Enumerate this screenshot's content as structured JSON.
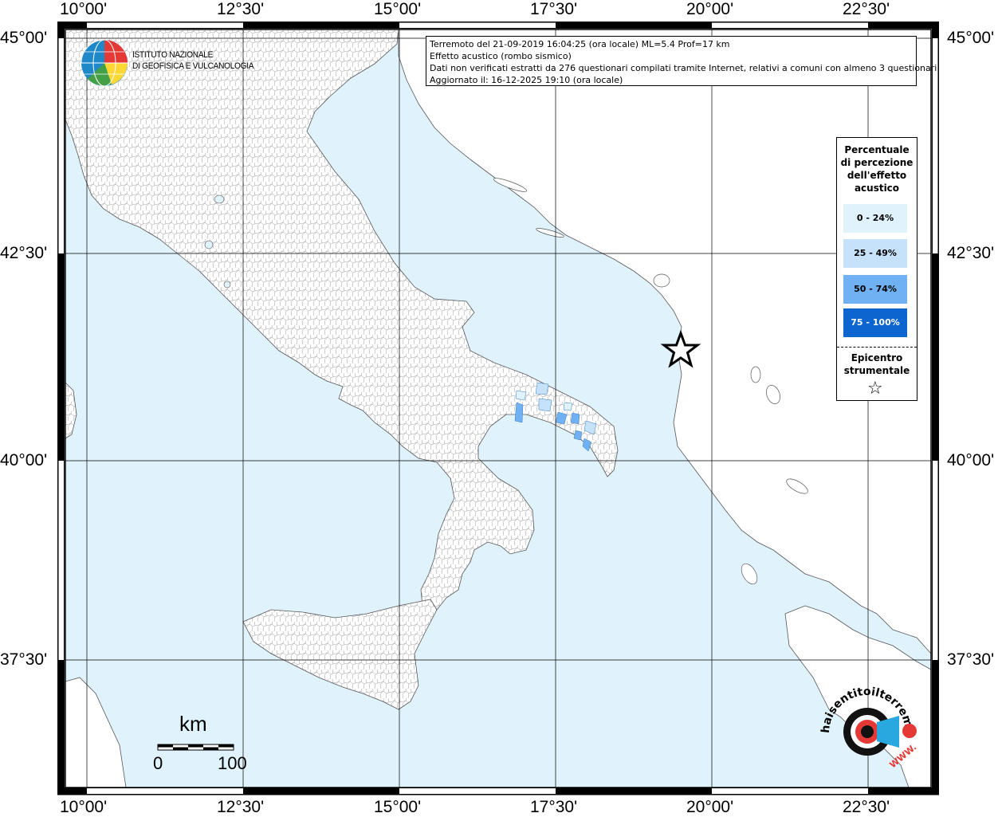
{
  "info": {
    "line1": "Terremoto del 21-09-2019 16:04:25 (ora locale) ML=5.4 Prof=17 km",
    "line2": "Effetto acustico (rombo sismico)",
    "line3": "Dati non verificati estratti da 276 questionari compilati tramite Internet, relativi a comuni con almeno 3 questionari.",
    "line4": "Aggiornato il: 16-12-2025 19:10 (ora locale)"
  },
  "institute": {
    "line1": "ISTITUTO NAZIONALE",
    "line2": "DI GEOFISICA E VULCANOLOGIA"
  },
  "axes": {
    "lon_ticks": [
      "10°00'",
      "12°30'",
      "15°00'",
      "17°30'",
      "20°00'",
      "22°30'"
    ],
    "lat_ticks": [
      "45°00'",
      "42°30'",
      "40°00'",
      "37°30'"
    ]
  },
  "legend": {
    "title": "Percentuale di percezione dell'effetto acustico",
    "title_lines": [
      "Percentuale",
      "di percezione",
      "dell'effetto",
      "acustico"
    ],
    "items": [
      {
        "label": "0 - 24%",
        "color": "#e0f3fd"
      },
      {
        "label": "25 - 49%",
        "color": "#c6e2fa"
      },
      {
        "label": "50 - 74%",
        "color": "#6fb1f2"
      },
      {
        "label": "75 - 100%",
        "color": "#0d66d0"
      }
    ],
    "epicenter_lines": [
      "Epicentro",
      "strumentale"
    ],
    "epicenter_symbol": "☆"
  },
  "scale": {
    "unit": "km",
    "start": "0",
    "end": "100"
  },
  "colors": {
    "sea": "#e0f3fd",
    "land": "#ffffff",
    "frame": "#000000"
  },
  "watermark": {
    "text": "haisentitoilterremoto.it",
    "www": "WWW."
  }
}
